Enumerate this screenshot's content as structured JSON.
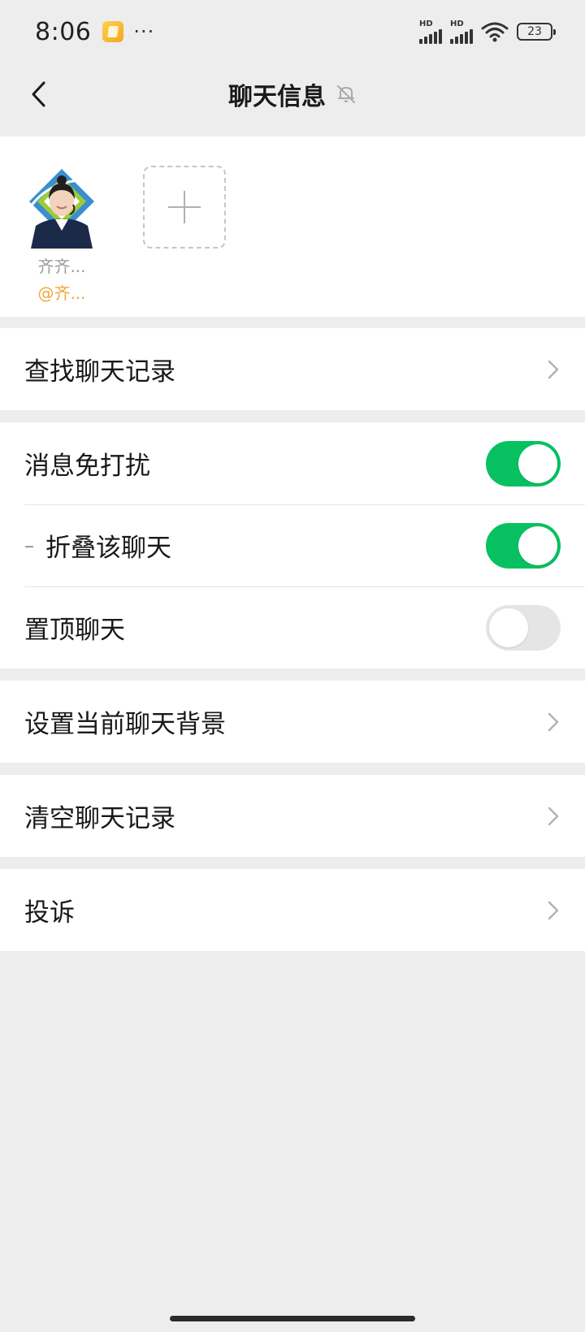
{
  "status_bar": {
    "time": "8:06",
    "app_icon": "notes-app-icon",
    "more": "···",
    "signal1_label": "HD",
    "signal2_label": "HD",
    "battery": "23"
  },
  "nav": {
    "title": "聊天信息",
    "back_icon": "back-chevron-icon",
    "mute_icon": "bell-muted-icon"
  },
  "members": [
    {
      "name": "齐齐...",
      "at": "@齐..."
    }
  ],
  "add_member_icon": "plus-icon",
  "sections": {
    "search": {
      "label": "查找聊天记录"
    },
    "settings": [
      {
        "label": "消息免打扰",
        "on": true
      },
      {
        "label": "折叠该聊天",
        "prefix": "–",
        "on": true
      },
      {
        "label": "置顶聊天",
        "on": false
      }
    ],
    "background": {
      "label": "设置当前聊天背景"
    },
    "clear": {
      "label": "清空聊天记录"
    },
    "complain": {
      "label": "投诉"
    }
  },
  "colors": {
    "toggle_on": "#07c160",
    "toggle_off": "#e5e5e5",
    "at_mention": "#f0a63a",
    "page_bg": "#ededed"
  }
}
